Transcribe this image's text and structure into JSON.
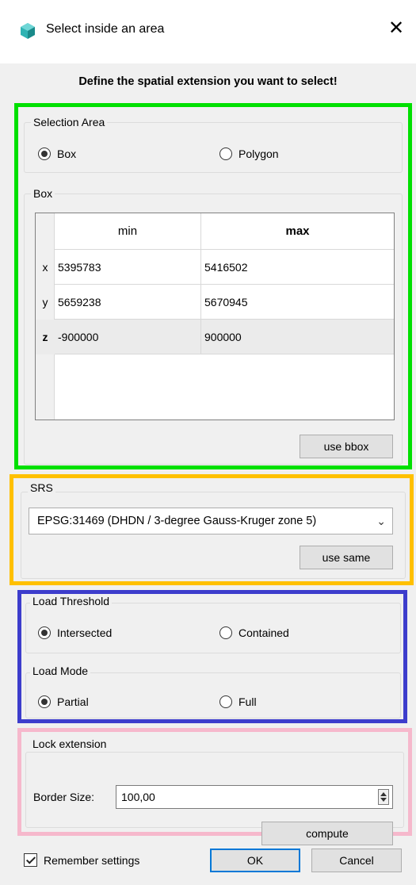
{
  "window": {
    "title": "Select inside an area",
    "close_glyph": "✕",
    "app_icon": "cube-logo-icon"
  },
  "heading": "Define the spatial extension you want to select!",
  "selection_area": {
    "title": "Selection Area",
    "options": [
      {
        "label": "Box",
        "checked": true
      },
      {
        "label": "Polygon",
        "checked": false
      }
    ]
  },
  "box": {
    "title": "Box",
    "columns": [
      "min",
      "max"
    ],
    "rows": [
      {
        "label": "x",
        "min": "5395783",
        "max": "5416502"
      },
      {
        "label": "y",
        "min": "5659238",
        "max": "5670945"
      },
      {
        "label": "z",
        "min": "-900000",
        "max": "900000"
      }
    ],
    "use_bbox_label": "use bbox"
  },
  "srs": {
    "title": "SRS",
    "selected": "EPSG:31469 (DHDN / 3-degree Gauss-Kruger zone 5)",
    "use_same_label": "use same"
  },
  "load_threshold": {
    "title": "Load Threshold",
    "options": [
      {
        "label": "Intersected",
        "checked": true
      },
      {
        "label": "Contained",
        "checked": false
      }
    ]
  },
  "load_mode": {
    "title": "Load Mode",
    "options": [
      {
        "label": "Partial",
        "checked": true
      },
      {
        "label": "Full",
        "checked": false
      }
    ]
  },
  "lock_extension": {
    "title": "Lock extension",
    "border_size_label": "Border Size:",
    "border_size_value": "100,00",
    "compute_label": "compute"
  },
  "footer": {
    "remember_label": "Remember settings",
    "remember_checked": true,
    "ok_label": "OK",
    "cancel_label": "Cancel"
  },
  "colors": {
    "highlight_green": "#00e000",
    "highlight_yellow": "#ffc000",
    "highlight_blue": "#3d3dcc",
    "highlight_pink": "#f6b8cc",
    "dialog_bg": "#f0f0f0",
    "default_button_border": "#0078d7"
  }
}
